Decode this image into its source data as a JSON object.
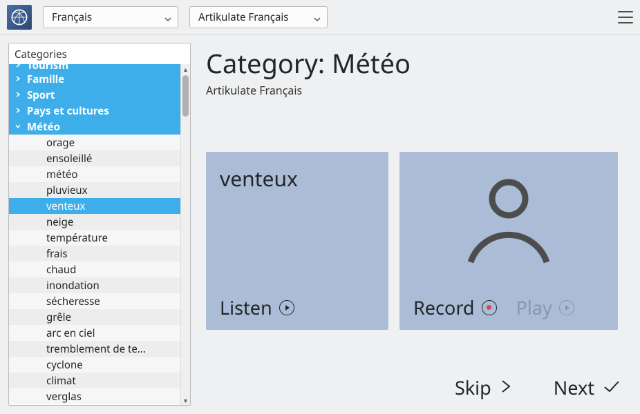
{
  "toolbar": {
    "language_selected": "Français",
    "course_selected": "Artikulate Français"
  },
  "sidebar": {
    "title": "Categories",
    "parents": [
      {
        "label": "Tourism",
        "expanded": false,
        "cut": true
      },
      {
        "label": "Famille",
        "expanded": false
      },
      {
        "label": "Sport",
        "expanded": false
      },
      {
        "label": "Pays et cultures",
        "expanded": false
      },
      {
        "label": "Météo",
        "expanded": true
      }
    ],
    "leaves": [
      "orage",
      "ensoleillé",
      "météo",
      "pluvieux",
      "venteux",
      "neige",
      "température",
      "frais",
      "chaud",
      "inondation",
      "sécheresse",
      "grêle",
      "arc en ciel",
      "tremblement de te...",
      "cyclone",
      "climat",
      "verglas"
    ],
    "selected_leaf": "venteux"
  },
  "main": {
    "heading_prefix": "Category: ",
    "heading_category": "Météo",
    "subtitle": "Artikulate Français",
    "current_word": "venteux",
    "listen_label": "Listen",
    "record_label": "Record",
    "play_label": "Play",
    "skip_label": "Skip",
    "next_label": "Next"
  }
}
